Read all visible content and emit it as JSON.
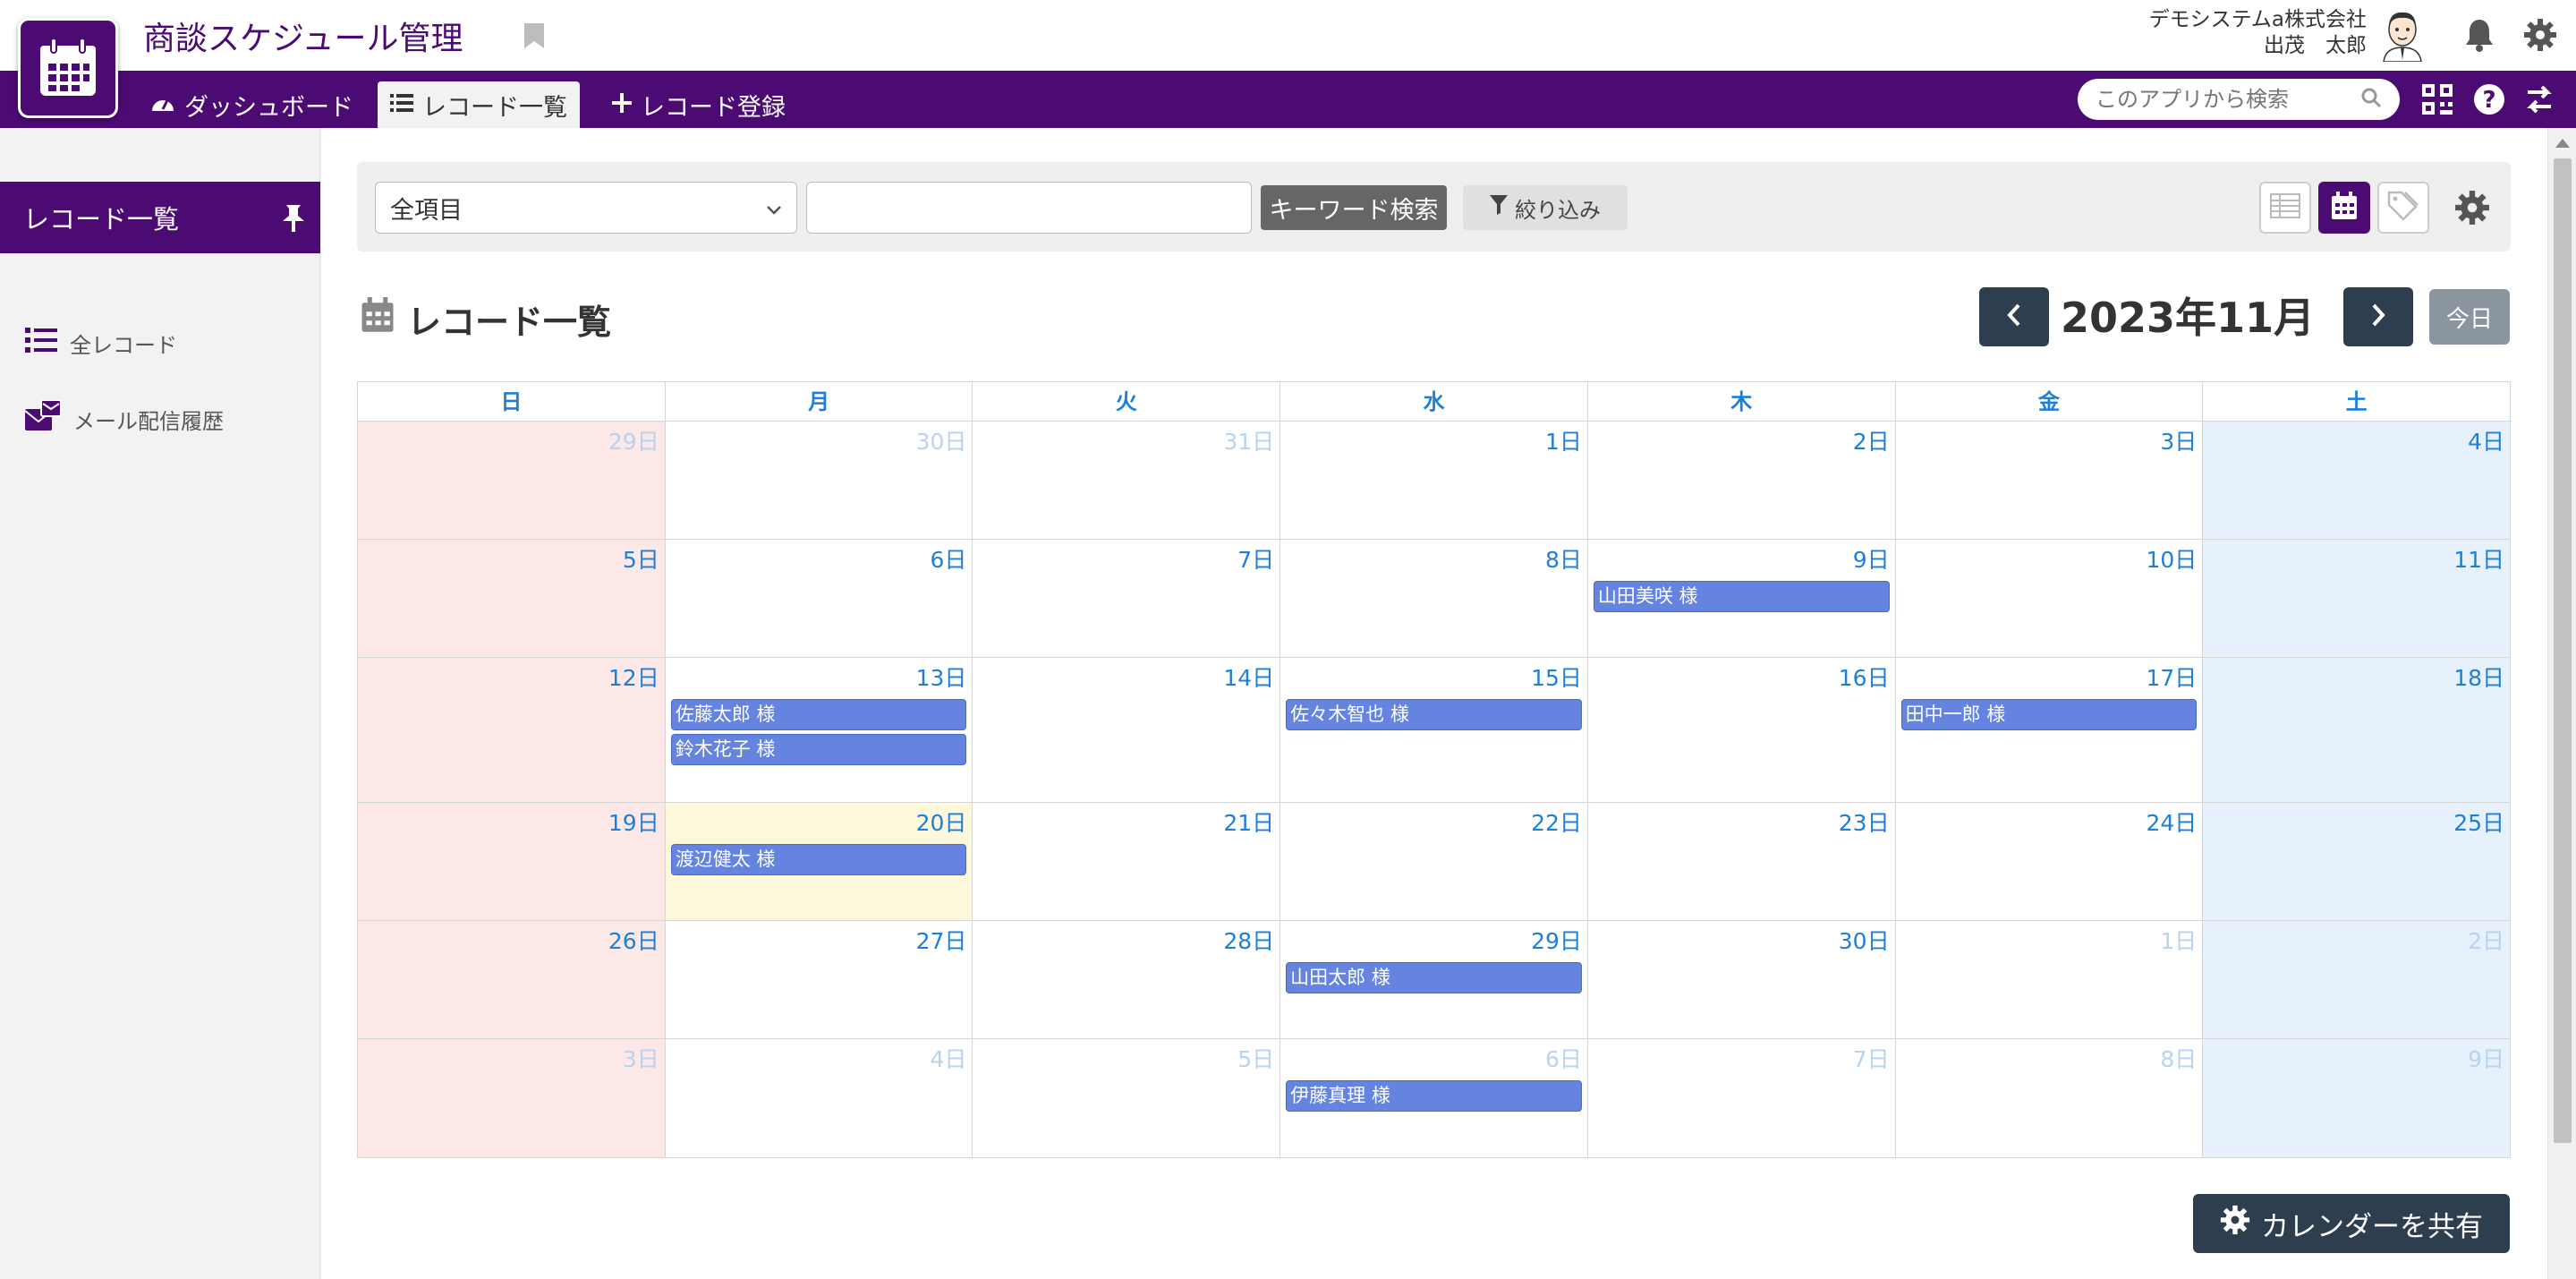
{
  "header": {
    "app_title": "商談スケジュール管理",
    "company": "デモシステムa株式会社",
    "user": "出茂　太郎"
  },
  "nav": {
    "dashboard": "ダッシュボード",
    "record_list": "レコード一覧",
    "record_add": "レコード登録",
    "search_placeholder": "このアプリから検索"
  },
  "sidebar": {
    "title": "レコード一覧",
    "items": [
      {
        "label": "全レコード",
        "icon": "list-icon"
      },
      {
        "label": "メール配信履歴",
        "icon": "mail-history-icon"
      }
    ]
  },
  "toolbar": {
    "select_value": "全項目",
    "keyword_value": "",
    "keyword_button": "キーワード検索",
    "filter_button": "絞り込み"
  },
  "list_title": "レコード一覧",
  "calendar": {
    "month_label": "2023年11月",
    "today_button": "今日",
    "weekdays": [
      "日",
      "月",
      "火",
      "水",
      "木",
      "金",
      "土"
    ],
    "weeks": [
      [
        {
          "label": "29日",
          "other": true,
          "events": []
        },
        {
          "label": "30日",
          "other": true,
          "events": []
        },
        {
          "label": "31日",
          "other": true,
          "events": []
        },
        {
          "label": "1日",
          "other": false,
          "events": []
        },
        {
          "label": "2日",
          "other": false,
          "events": []
        },
        {
          "label": "3日",
          "other": false,
          "events": []
        },
        {
          "label": "4日",
          "other": false,
          "events": []
        }
      ],
      [
        {
          "label": "5日",
          "other": false,
          "events": []
        },
        {
          "label": "6日",
          "other": false,
          "events": []
        },
        {
          "label": "7日",
          "other": false,
          "events": []
        },
        {
          "label": "8日",
          "other": false,
          "events": []
        },
        {
          "label": "9日",
          "other": false,
          "events": [
            "山田美咲 様"
          ]
        },
        {
          "label": "10日",
          "other": false,
          "events": []
        },
        {
          "label": "11日",
          "other": false,
          "events": []
        }
      ],
      [
        {
          "label": "12日",
          "other": false,
          "events": []
        },
        {
          "label": "13日",
          "other": false,
          "events": [
            "佐藤太郎 様",
            "鈴木花子 様"
          ]
        },
        {
          "label": "14日",
          "other": false,
          "events": []
        },
        {
          "label": "15日",
          "other": false,
          "events": [
            "佐々木智也 様"
          ]
        },
        {
          "label": "16日",
          "other": false,
          "events": []
        },
        {
          "label": "17日",
          "other": false,
          "events": [
            "田中一郎 様"
          ]
        },
        {
          "label": "18日",
          "other": false,
          "events": []
        }
      ],
      [
        {
          "label": "19日",
          "other": false,
          "events": []
        },
        {
          "label": "20日",
          "other": false,
          "today": true,
          "events": [
            "渡辺健太 様"
          ]
        },
        {
          "label": "21日",
          "other": false,
          "events": []
        },
        {
          "label": "22日",
          "other": false,
          "events": []
        },
        {
          "label": "23日",
          "other": false,
          "events": []
        },
        {
          "label": "24日",
          "other": false,
          "events": []
        },
        {
          "label": "25日",
          "other": false,
          "events": []
        }
      ],
      [
        {
          "label": "26日",
          "other": false,
          "events": []
        },
        {
          "label": "27日",
          "other": false,
          "events": []
        },
        {
          "label": "28日",
          "other": false,
          "events": []
        },
        {
          "label": "29日",
          "other": false,
          "events": [
            "山田太郎 様"
          ]
        },
        {
          "label": "30日",
          "other": false,
          "events": []
        },
        {
          "label": "1日",
          "other": true,
          "events": []
        },
        {
          "label": "2日",
          "other": true,
          "events": []
        }
      ],
      [
        {
          "label": "3日",
          "other": true,
          "events": []
        },
        {
          "label": "4日",
          "other": true,
          "events": []
        },
        {
          "label": "5日",
          "other": true,
          "events": []
        },
        {
          "label": "6日",
          "other": true,
          "events": [
            "伊藤真理 様"
          ]
        },
        {
          "label": "7日",
          "other": true,
          "events": []
        },
        {
          "label": "8日",
          "other": true,
          "events": []
        },
        {
          "label": "9日",
          "other": true,
          "events": []
        }
      ]
    ]
  },
  "share_button": "カレンダーを共有",
  "colors": {
    "brand": "#4c0b73",
    "event": "#6484e0",
    "day_text": "#1e7fd8",
    "sunday_bg": "#fde8e8",
    "saturday_bg": "#e6f1fb",
    "today_bg": "#fdf7dc",
    "dark_button": "#2f3e4e"
  }
}
